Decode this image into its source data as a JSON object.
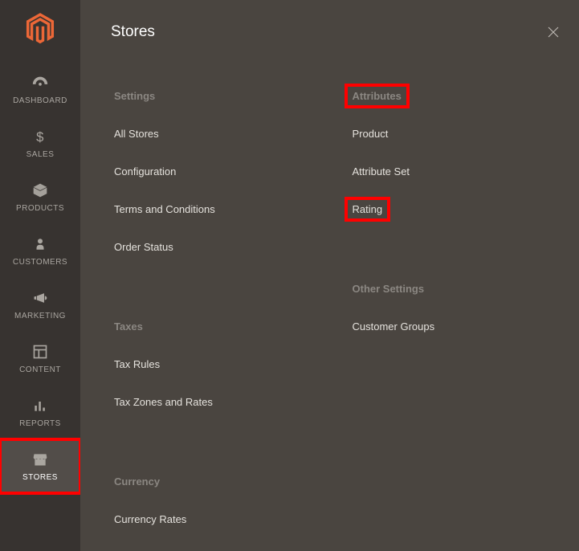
{
  "sidebar": {
    "items": [
      {
        "label": "DASHBOARD",
        "name": "sidebar-item-dashboard",
        "iconName": "gauge-icon",
        "svg": "gauge"
      },
      {
        "label": "SALES",
        "name": "sidebar-item-sales",
        "iconName": "dollar-icon",
        "svg": "dollar"
      },
      {
        "label": "PRODUCTS",
        "name": "sidebar-item-products",
        "iconName": "box-icon",
        "svg": "box"
      },
      {
        "label": "CUSTOMERS",
        "name": "sidebar-item-customers",
        "iconName": "person-icon",
        "svg": "person"
      },
      {
        "label": "MARKETING",
        "name": "sidebar-item-marketing",
        "iconName": "megaphone-icon",
        "svg": "megaphone"
      },
      {
        "label": "CONTENT",
        "name": "sidebar-item-content",
        "iconName": "layout-icon",
        "svg": "layout"
      },
      {
        "label": "REPORTS",
        "name": "sidebar-item-reports",
        "iconName": "bars-icon",
        "svg": "bars"
      },
      {
        "label": "STORES",
        "name": "sidebar-item-stores",
        "iconName": "store-icon",
        "svg": "store",
        "active": true,
        "highlight": true
      }
    ]
  },
  "panel": {
    "title": "Stores",
    "columns": {
      "left": [
        {
          "type": "heading",
          "text": "Settings",
          "name": "group-heading-settings"
        },
        {
          "type": "link",
          "text": "All Stores",
          "name": "menu-link-all-stores"
        },
        {
          "type": "link",
          "text": "Configuration",
          "name": "menu-link-configuration"
        },
        {
          "type": "link",
          "text": "Terms and Conditions",
          "name": "menu-link-terms"
        },
        {
          "type": "link",
          "text": "Order Status",
          "name": "menu-link-order-status"
        },
        {
          "type": "gap"
        },
        {
          "type": "heading",
          "text": "Taxes",
          "name": "group-heading-taxes"
        },
        {
          "type": "link",
          "text": "Tax Rules",
          "name": "menu-link-tax-rules"
        },
        {
          "type": "link",
          "text": "Tax Zones and Rates",
          "name": "menu-link-tax-zones"
        },
        {
          "type": "gap"
        },
        {
          "type": "heading",
          "text": "Currency",
          "name": "group-heading-currency"
        },
        {
          "type": "link",
          "text": "Currency Rates",
          "name": "menu-link-currency-rates"
        }
      ],
      "right": [
        {
          "type": "heading",
          "text": "Attributes",
          "name": "group-heading-attributes",
          "highlight": true
        },
        {
          "type": "link",
          "text": "Product",
          "name": "menu-link-product"
        },
        {
          "type": "link",
          "text": "Attribute Set",
          "name": "menu-link-attribute-set"
        },
        {
          "type": "link",
          "text": "Rating",
          "name": "menu-link-rating",
          "highlight": true
        },
        {
          "type": "gap"
        },
        {
          "type": "heading",
          "text": "Other Settings",
          "name": "group-heading-other-settings"
        },
        {
          "type": "link",
          "text": "Customer Groups",
          "name": "menu-link-customer-groups"
        }
      ]
    }
  }
}
